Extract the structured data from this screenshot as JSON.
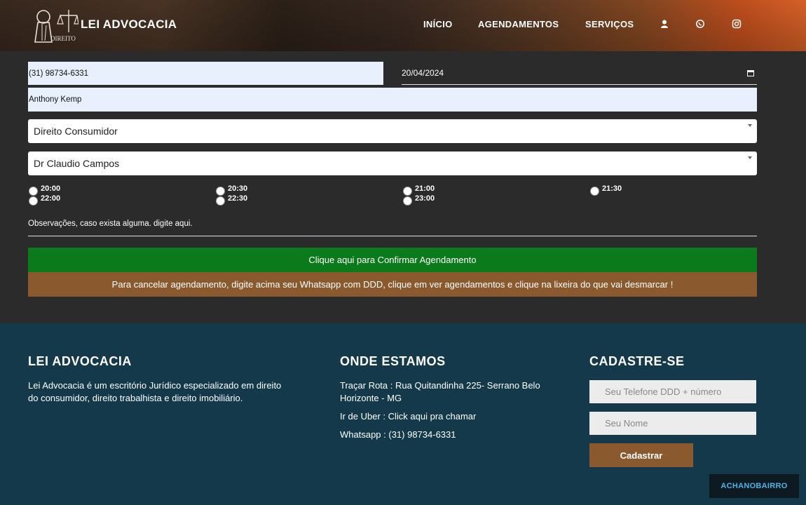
{
  "header": {
    "brand": "LEI ADVOCACIA",
    "logo_text": "DIREITO",
    "nav": [
      "INÍCIO",
      "AGENDAMENTOS",
      "SERVIÇOS"
    ],
    "icons": [
      "user-icon",
      "whatsapp-icon",
      "instagram-icon"
    ]
  },
  "form": {
    "phone_value": "(31) 98734-6331",
    "date_value": "20/04/2024",
    "name_value": "Anthony Kemp",
    "service_selected": "Direito Consumidor",
    "lawyer_selected": "Dr Claudio Campos",
    "time_slots": [
      "20:00",
      "22:00",
      "20:30",
      "22:30",
      "21:00",
      "23:00",
      "21:30"
    ],
    "observations_placeholder": "Observações, caso exista alguma. digite aqui.",
    "confirm_label": "Clique aqui para Confirmar Agendamento",
    "cancel_info": "Para cancelar agendamento, digite acima seu Whatsapp com DDD, clique em ver agendamentos e clique na lixeira do que vai desmarcar !"
  },
  "footer": {
    "about_title": "LEI ADVOCACIA",
    "about_line1": "Lei Advocacia é um escritório Jurídico especializado em direito",
    "about_line2": "do consumidor, direito trabalhista e direito imobiliário.",
    "location_title": "ONDE ESTAMOS",
    "route_line1": "Traçar Rota : Rua Quitandinha 225- Serrano Belo",
    "route_line2": "Horizonte - MG",
    "uber": "Ir de Uber : Click aqui pra chamar",
    "whatsapp": "Whatsapp : (31) 98734-6331",
    "signup_title": "CADASTRE-SE",
    "phone_placeholder": "Seu Telefone DDD + número",
    "name_placeholder": "Seu Nome",
    "signup_button": "Cadastrar",
    "badge": "ACHANOBAIRRO"
  },
  "colors": {
    "body_bg": "#2b2b2b",
    "footer_bg": "#13394a",
    "confirm_green": "#0a7a1a",
    "brown": "#8a5a2e",
    "field_bg": "#e8f0fe"
  }
}
